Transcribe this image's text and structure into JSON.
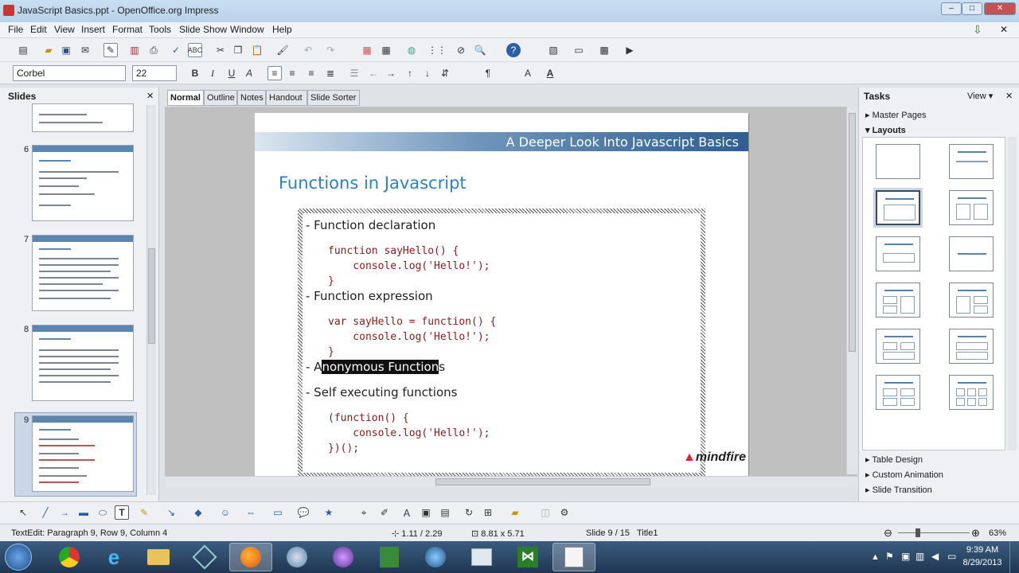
{
  "window": {
    "title": "JavaScript Basics.ppt - OpenOffice.org Impress",
    "min": "–",
    "max": "□",
    "close": "✕"
  },
  "menu": [
    "File",
    "Edit",
    "View",
    "Insert",
    "Format",
    "Tools",
    "Slide Show",
    "Window",
    "Help"
  ],
  "format_bar": {
    "font": "Corbel",
    "size": "22"
  },
  "slides_panel": {
    "title": "Slides",
    "close": "✕",
    "thumbs": [
      {
        "num": "6"
      },
      {
        "num": "7"
      },
      {
        "num": "8"
      },
      {
        "num": "9"
      }
    ]
  },
  "view_tabs": [
    "Normal",
    "Outline",
    "Notes",
    "Handout",
    "Slide Sorter"
  ],
  "slide": {
    "band_title": "A Deeper Look Into Javascript Basics",
    "title": "Functions in Javascript",
    "items": [
      {
        "bullet": "- Function declaration",
        "code": "function sayHello() {\n    console.log('Hello!');\n}"
      },
      {
        "bullet": "- Function expression",
        "code": "var sayHello = function() {\n    console.log('Hello!');\n}"
      },
      {
        "bullet_pre": "- A",
        "bullet_sel": "nonymous Function",
        "bullet_post": "s"
      },
      {
        "bullet": "- Self executing functions",
        "code": "(function() {\n    console.log('Hello!');\n})();"
      }
    ],
    "logo": "mindfire"
  },
  "tasks_panel": {
    "title": "Tasks",
    "view": "View ▾",
    "close": "✕",
    "sections_top": [
      "Master Pages",
      "Layouts"
    ],
    "sections_bottom": [
      "Table Design",
      "Custom Animation",
      "Slide Transition"
    ]
  },
  "status": {
    "text": "TextEdit: Paragraph 9, Row 9, Column 4",
    "position": "1.11 / 2.29",
    "size": "8.81 x 5.71",
    "slide": "Slide 9 / 15",
    "layout": "Title1",
    "zoom": "63%"
  },
  "clock": {
    "time": "9:39 AM",
    "date": "8/29/2013"
  },
  "colors": {
    "accent": "#2f7fbf",
    "band": "#2d5f90",
    "code": "#8b1a1a"
  }
}
